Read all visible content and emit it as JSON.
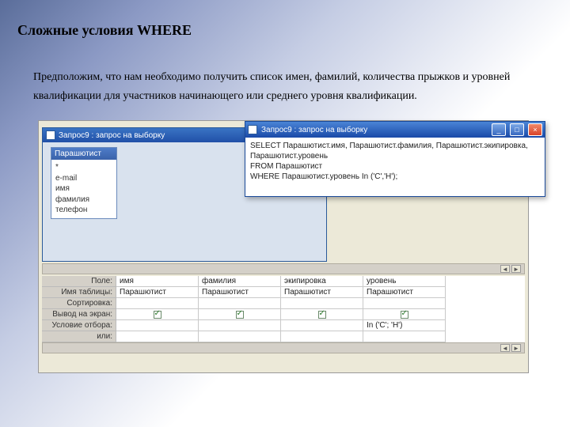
{
  "title": "Сложные условия WHERE",
  "paragraph": "Предположим, что нам необходимо получить список имен, фамилий, количества прыжков и уровней квалификации для участников начинающего или среднего уровня квалификации.",
  "designer": {
    "caption": "Запрос9 : запрос на выборку",
    "table": {
      "name": "Парашютист",
      "fields": [
        "*",
        "e-mail",
        "имя",
        "фамилия",
        "телефон"
      ]
    }
  },
  "sqlWin": {
    "caption": "Запрос9 : запрос на выборку",
    "lines": [
      "SELECT Парашютист.имя, Парашютист.фамилия, Парашютист.экипировка, Парашютист.уровень",
      "FROM Парашютист",
      "WHERE Парашютист.уровень In ('С','Н');"
    ]
  },
  "qbe": {
    "rows": [
      "Поле:",
      "Имя таблицы:",
      "Сортировка:",
      "Вывод на экран:",
      "Условие отбора:",
      "или:"
    ],
    "cols": [
      {
        "field": "имя",
        "table": "Парашютист",
        "show": true,
        "cond": ""
      },
      {
        "field": "фамилия",
        "table": "Парашютист",
        "show": true,
        "cond": ""
      },
      {
        "field": "экипировка",
        "table": "Парашютист",
        "show": true,
        "cond": ""
      },
      {
        "field": "уровень",
        "table": "Парашютист",
        "show": true,
        "cond": "In ('С'; 'Н')"
      }
    ]
  }
}
